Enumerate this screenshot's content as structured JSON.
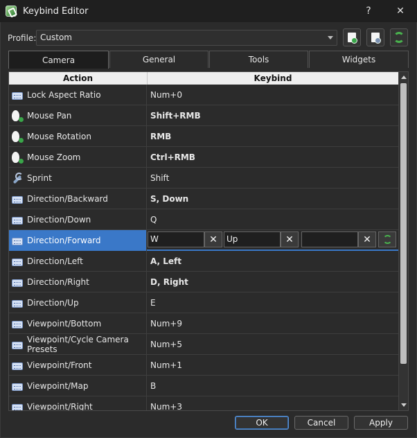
{
  "window": {
    "title": "Keybind Editor",
    "help_glyph": "?",
    "close_glyph": "✕"
  },
  "profile": {
    "label": "Profile:",
    "value": "Custom"
  },
  "tabs": [
    {
      "label": "Camera",
      "active": true
    },
    {
      "label": "General",
      "active": false
    },
    {
      "label": "Tools",
      "active": false
    },
    {
      "label": "Widgets",
      "active": false
    }
  ],
  "table": {
    "headers": {
      "action": "Action",
      "keybind": "Keybind"
    },
    "rows": [
      {
        "icon": "keyboard-icon",
        "action": "Lock Aspect Ratio",
        "keybind": "Num+0",
        "bold": false
      },
      {
        "icon": "mouse-icon",
        "action": "Mouse Pan",
        "keybind": "Shift+RMB",
        "bold": true
      },
      {
        "icon": "mouse-icon",
        "action": "Mouse Rotation",
        "keybind": "RMB",
        "bold": true
      },
      {
        "icon": "mouse-icon",
        "action": "Mouse Zoom",
        "keybind": "Ctrl+RMB",
        "bold": true
      },
      {
        "icon": "wrench-icon",
        "action": "Sprint",
        "keybind": "Shift",
        "bold": false
      },
      {
        "icon": "keyboard-icon",
        "action": "Direction/Backward",
        "keybind": "S, Down",
        "bold": true
      },
      {
        "icon": "keyboard-icon",
        "action": "Direction/Down",
        "keybind": "Q",
        "bold": false
      },
      {
        "icon": "keyboard-icon",
        "action": "Direction/Forward",
        "keybind": "",
        "bold": false,
        "selected": true
      },
      {
        "icon": "keyboard-icon",
        "action": "Direction/Left",
        "keybind": "A, Left",
        "bold": true
      },
      {
        "icon": "keyboard-icon",
        "action": "Direction/Right",
        "keybind": "D, Right",
        "bold": true
      },
      {
        "icon": "keyboard-icon",
        "action": "Direction/Up",
        "keybind": "E",
        "bold": false
      },
      {
        "icon": "keyboard-icon",
        "action": "Viewpoint/Bottom",
        "keybind": "Num+9",
        "bold": false
      },
      {
        "icon": "keyboard-icon",
        "action": "Viewpoint/Cycle Camera Presets",
        "keybind": "Num+5",
        "bold": false
      },
      {
        "icon": "keyboard-icon",
        "action": "Viewpoint/Front",
        "keybind": "Num+1",
        "bold": false
      },
      {
        "icon": "keyboard-icon",
        "action": "Viewpoint/Map",
        "keybind": "B",
        "bold": false
      },
      {
        "icon": "keyboard-icon",
        "action": "Viewpoint/Right",
        "keybind": "Num+3",
        "bold": false
      }
    ]
  },
  "editor": {
    "binding1": "W",
    "binding2": "Up",
    "binding3": "",
    "clear_glyph": "✕"
  },
  "buttons": {
    "ok": "OK",
    "cancel": "Cancel",
    "apply": "Apply"
  },
  "colors": {
    "selection": "#3a78c8",
    "accent_green": "#49b24e"
  }
}
